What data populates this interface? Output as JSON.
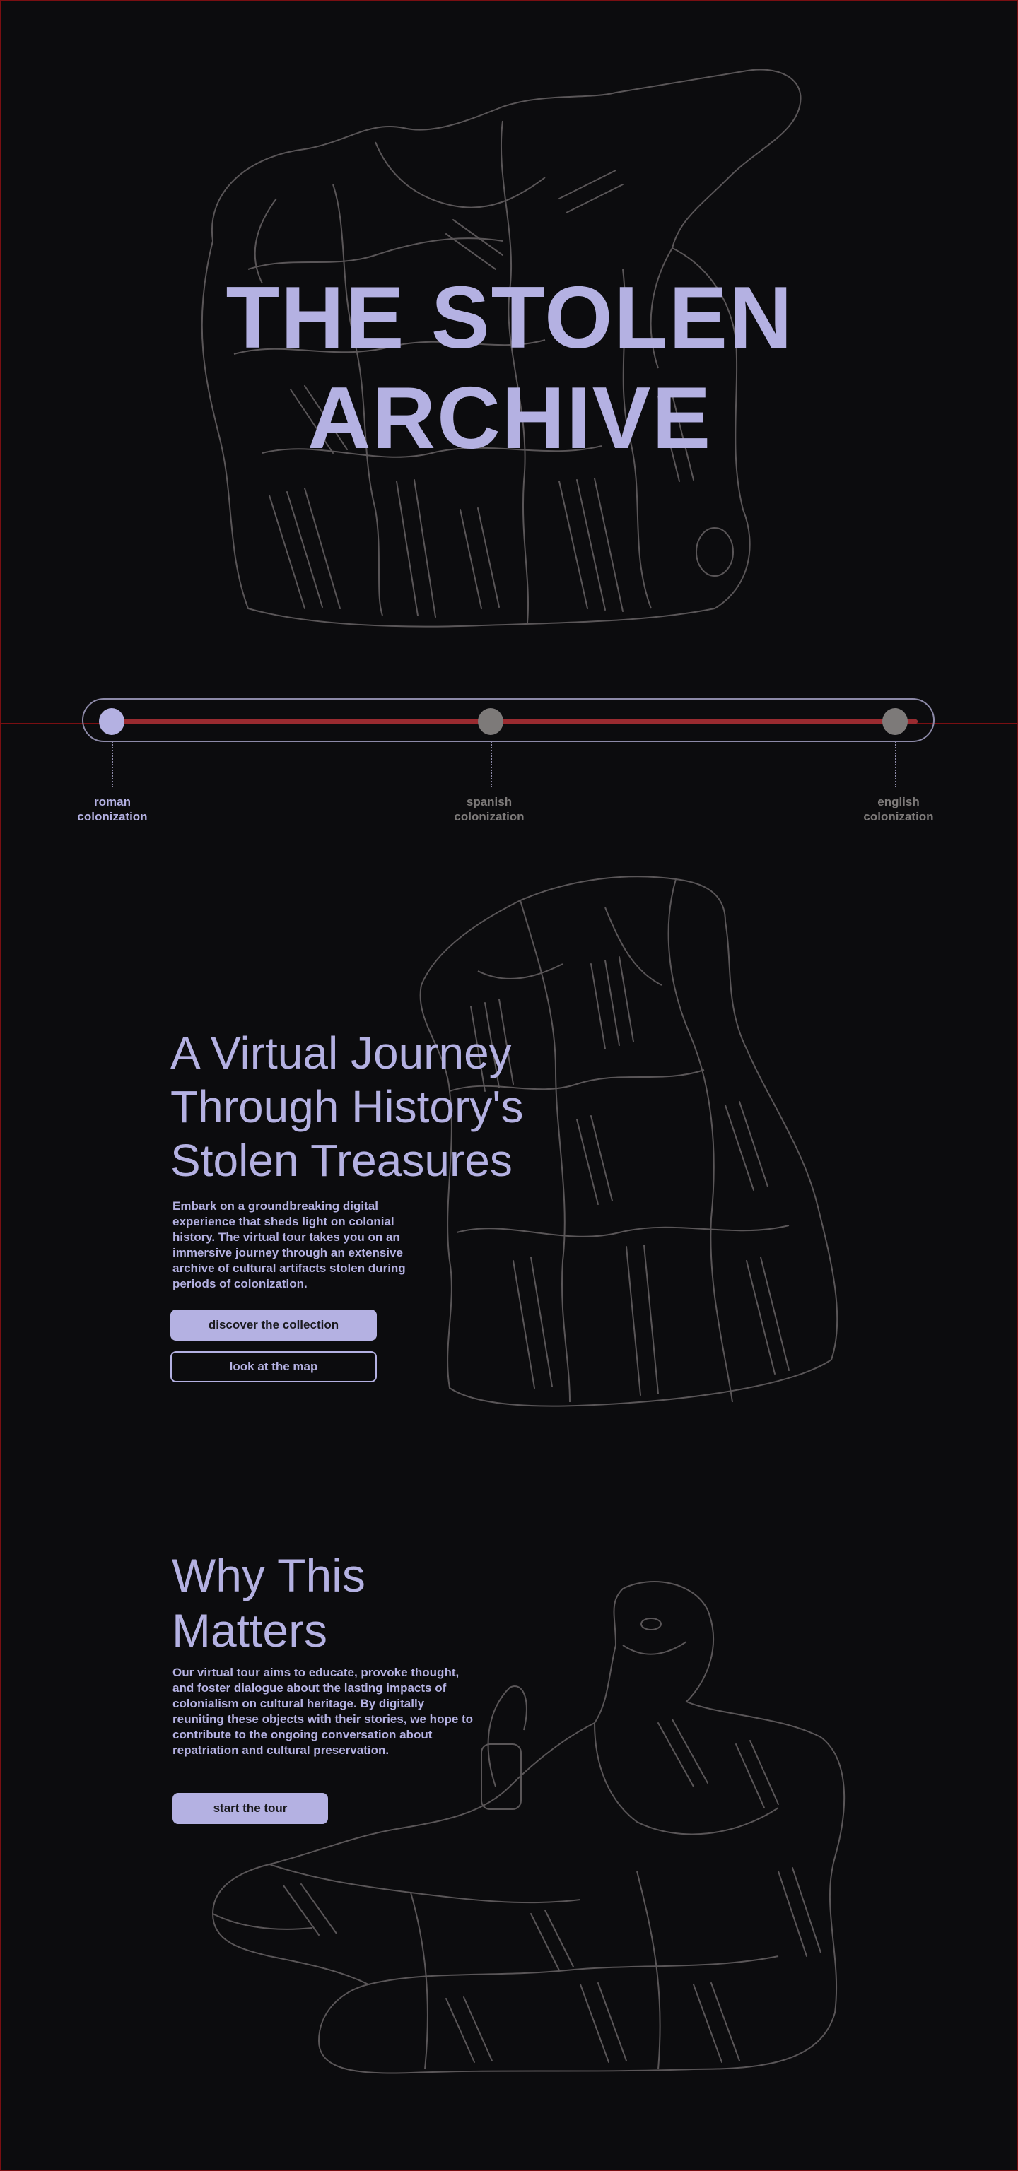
{
  "hero": {
    "title_line1": "THE STOLEN",
    "title_line2": "ARCHIVE"
  },
  "timeline": {
    "progress": 1.0,
    "eras": [
      {
        "line1": "roman",
        "line2": "colonization",
        "active": true
      },
      {
        "line1": "spanish",
        "line2": "colonization",
        "active": false
      },
      {
        "line1": "english",
        "line2": "colonization",
        "active": false
      }
    ]
  },
  "journey": {
    "title": "A Virtual Journey Through History's Stolen Treasures",
    "body": "Embark on a groundbreaking digital experience that sheds light on colonial history. The virtual tour takes you on an immersive journey through an extensive archive of cultural artifacts stolen during periods of colonization.",
    "primary_button": "discover the collection",
    "secondary_button": "look at the map"
  },
  "why": {
    "title": "Why This Matters",
    "body": "Our virtual tour aims to educate, provoke thought, and foster  dialogue about the lasting impacts of colonialism on cultural heritage.  By digitally reuniting these objects with their stories, we hope to  contribute to the ongoing conversation about repatriation and cultural preservation.",
    "button": "start the tour"
  },
  "colors": {
    "background": "#0c0c0e",
    "accent": "#b4b1e2",
    "sketch": "#5a5658",
    "track": "#7d7a79",
    "progress": "#9a2b30"
  }
}
